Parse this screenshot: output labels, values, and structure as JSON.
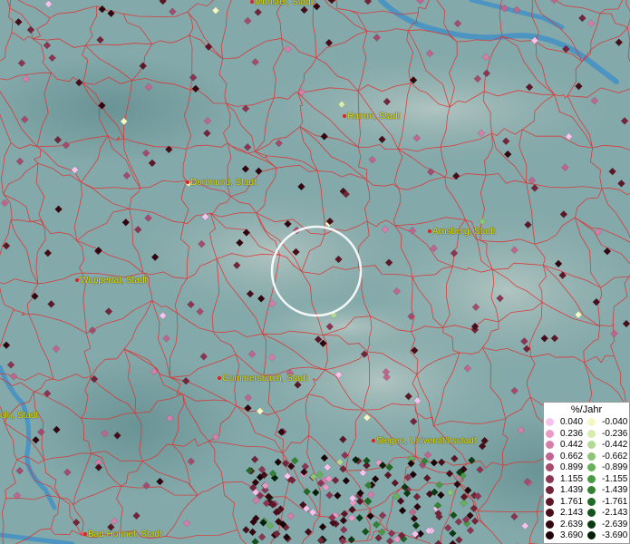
{
  "cities": [
    {
      "name": "Münster, Stadt",
      "key": "muenster"
    },
    {
      "name": "Hamm, Stadt",
      "key": "hamm"
    },
    {
      "name": "Dortmund, Stadt",
      "key": "dortmund"
    },
    {
      "name": "Arnsberg, Stadt",
      "key": "arnsberg"
    },
    {
      "name": "Wuppertal, Stadt",
      "key": "wuppertal"
    },
    {
      "name": "Gummersbach, Stadt",
      "key": "gummersbach"
    },
    {
      "name": "Siegen, Universitätsstadt",
      "key": "siegen"
    },
    {
      "name": "öln, Stadt",
      "key": "koeln"
    },
    {
      "name": "Bad Honnef, Stadt",
      "key": "badhonnef"
    }
  ],
  "legend": {
    "title": "%/Jahr",
    "positive": [
      {
        "label": "0.040",
        "color": "#f6c3ee"
      },
      {
        "label": "0.236",
        "color": "#e99bc6"
      },
      {
        "label": "0.442",
        "color": "#d47ea9"
      },
      {
        "label": "0.662",
        "color": "#c0658f"
      },
      {
        "label": "0.899",
        "color": "#a44b6e"
      },
      {
        "label": "1.155",
        "color": "#8b3552"
      },
      {
        "label": "1.439",
        "color": "#742539"
      },
      {
        "label": "1.761",
        "color": "#5e1727"
      },
      {
        "label": "2.143",
        "color": "#480d19"
      },
      {
        "label": "2.639",
        "color": "#33060f"
      },
      {
        "label": "3.690",
        "color": "#1d0206"
      }
    ],
    "negative": [
      {
        "label": "-0.040",
        "color": "#f4f7c4"
      },
      {
        "label": "-0.236",
        "color": "#d7edae"
      },
      {
        "label": "-0.442",
        "color": "#b3da94"
      },
      {
        "label": "-0.662",
        "color": "#8cc576"
      },
      {
        "label": "-0.899",
        "color": "#68b05b"
      },
      {
        "label": "-1.155",
        "color": "#4a9a45"
      },
      {
        "label": "-1.439",
        "color": "#338333"
      },
      {
        "label": "-1.761",
        "color": "#216a25"
      },
      {
        "label": "-2.143",
        "color": "#135219"
      },
      {
        "label": "-2.639",
        "color": "#0a3a10"
      },
      {
        "label": "-3.690",
        "color": "#032106"
      }
    ]
  },
  "colors": {
    "boundary": "#e03030",
    "water": "#3f8fc8",
    "highlight_circle": "#ffffff"
  }
}
